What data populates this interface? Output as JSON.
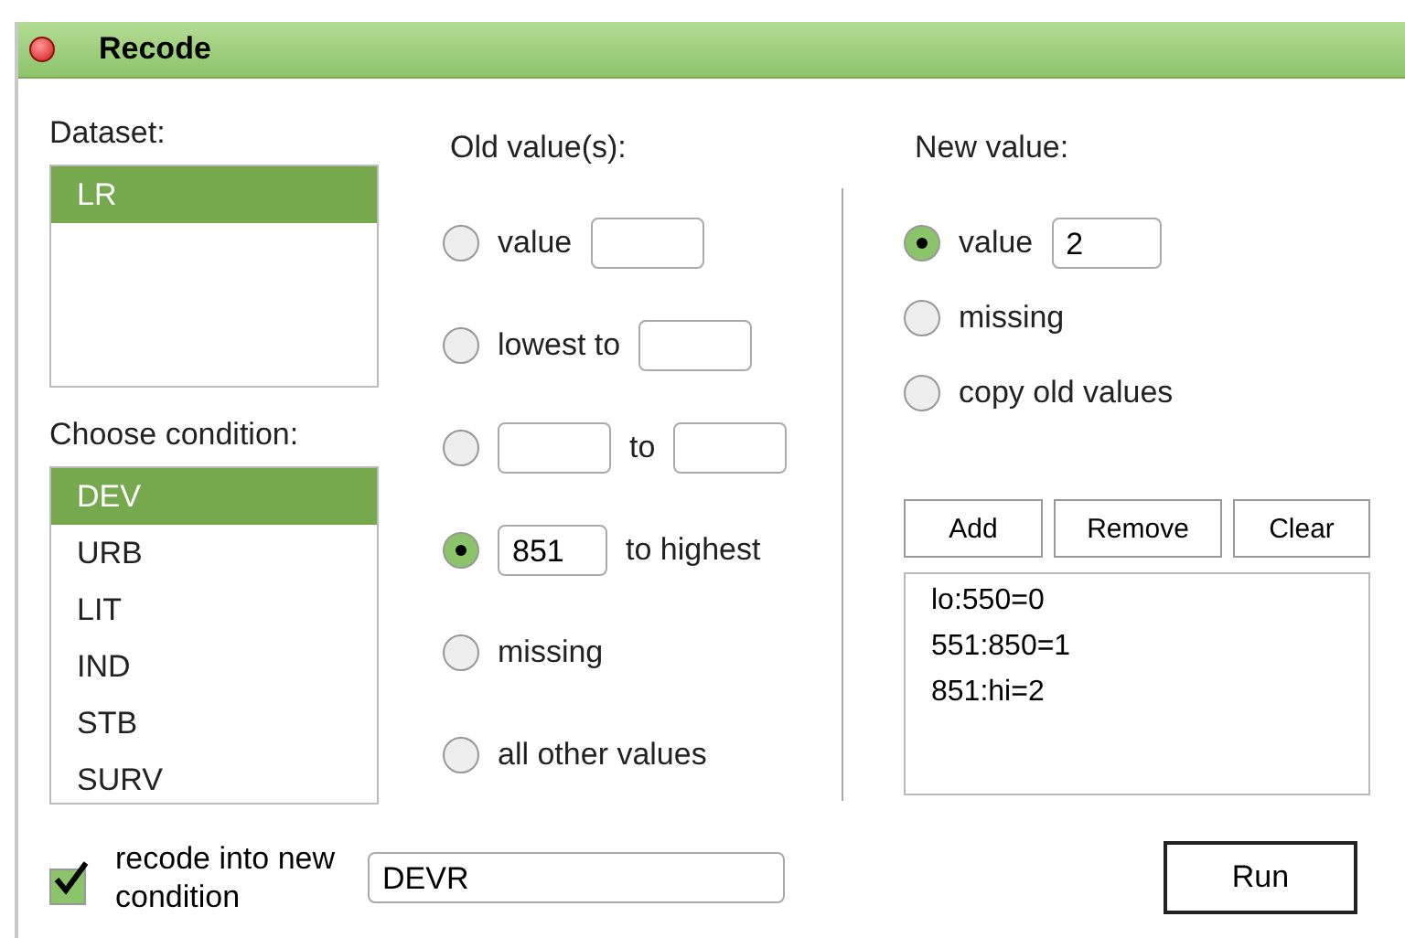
{
  "window": {
    "title": "Recode"
  },
  "dataset": {
    "label": "Dataset:",
    "items": [
      {
        "label": "LR",
        "selected": true
      }
    ]
  },
  "condition": {
    "label": "Choose condition:",
    "items": [
      {
        "label": "DEV",
        "selected": true
      },
      {
        "label": "URB",
        "selected": false
      },
      {
        "label": "LIT",
        "selected": false
      },
      {
        "label": "IND",
        "selected": false
      },
      {
        "label": "STB",
        "selected": false
      },
      {
        "label": "SURV",
        "selected": false
      }
    ]
  },
  "old_values": {
    "label": "Old value(s):",
    "options": [
      {
        "selected": false,
        "parts": [
          {
            "kind": "text",
            "text": "value"
          },
          {
            "kind": "field"
          }
        ]
      },
      {
        "selected": false,
        "parts": [
          {
            "kind": "text",
            "text": "lowest to"
          },
          {
            "kind": "field"
          }
        ]
      },
      {
        "selected": false,
        "parts": [
          {
            "kind": "field"
          },
          {
            "kind": "text",
            "text": "to"
          },
          {
            "kind": "field"
          }
        ]
      },
      {
        "selected": true,
        "parts": [
          {
            "kind": "field",
            "value": "851"
          },
          {
            "kind": "text",
            "text": "to highest"
          }
        ]
      },
      {
        "selected": false,
        "parts": [
          {
            "kind": "text",
            "text": "missing"
          }
        ]
      },
      {
        "selected": false,
        "parts": [
          {
            "kind": "text",
            "text": "all other values"
          }
        ]
      }
    ]
  },
  "new_value": {
    "label": "New value:",
    "options": [
      {
        "selected": true,
        "parts": [
          {
            "kind": "text",
            "text": "value"
          },
          {
            "kind": "field",
            "value": "2"
          }
        ]
      },
      {
        "selected": false,
        "parts": [
          {
            "kind": "text",
            "text": "missing"
          }
        ]
      },
      {
        "selected": false,
        "parts": [
          {
            "kind": "text",
            "text": "copy old values"
          }
        ]
      }
    ]
  },
  "buttons": [
    "Add",
    "Remove",
    "Clear"
  ],
  "rules": [
    "lo:550=0",
    "551:850=1",
    "851:hi=2"
  ],
  "recode_into": {
    "label": "recode into new condition",
    "checked": true,
    "value": "DEVR"
  },
  "run_button": "Run"
}
